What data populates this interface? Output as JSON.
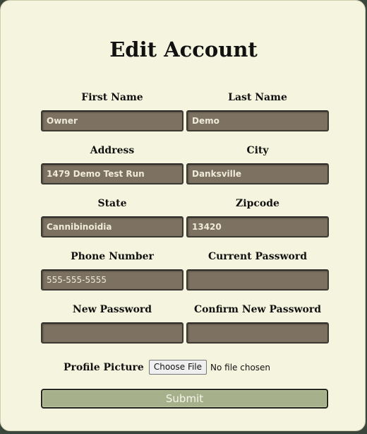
{
  "dialog": {
    "title": "Edit Account"
  },
  "fields": {
    "first_name": {
      "label": "First Name",
      "value": "Owner"
    },
    "last_name": {
      "label": "Last Name",
      "value": "Demo"
    },
    "address": {
      "label": "Address",
      "value": "1479 Demo Test Run"
    },
    "city": {
      "label": "City",
      "value": "Danksville"
    },
    "state": {
      "label": "State",
      "value": "Cannibinoidia"
    },
    "zipcode": {
      "label": "Zipcode",
      "value": "13420"
    },
    "phone": {
      "label": "Phone Number",
      "value": "555-555-5555"
    },
    "current_password": {
      "label": "Current Password",
      "value": ""
    },
    "new_password": {
      "label": "New Password",
      "value": ""
    },
    "confirm_password": {
      "label": "Confirm New Password",
      "value": ""
    }
  },
  "profile_picture": {
    "label": "Profile Picture",
    "button_label": "Choose File",
    "status": "No file chosen"
  },
  "submit": {
    "label": "Submit"
  },
  "colors": {
    "panel_bg": "#f5f5df",
    "input_bg": "#7d7262",
    "submit_bg": "#a6b08a"
  }
}
